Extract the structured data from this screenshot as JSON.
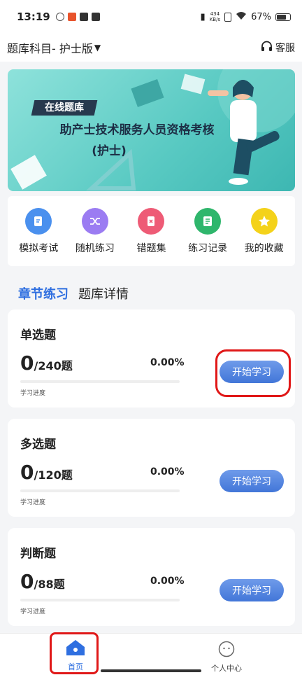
{
  "status_bar": {
    "time": "13:19",
    "net_speed_top": "434",
    "net_speed_unit": "KB/s",
    "battery": "67%"
  },
  "header": {
    "subject_label": "题库科目- 护士版",
    "service_label": "客服"
  },
  "banner": {
    "tag": "在线题库",
    "title": "助产士技术服务人员资格考核",
    "subtitle": "(护士)"
  },
  "quick_menu": {
    "items": [
      {
        "label": "模拟考试",
        "icon": "exam-icon",
        "color": "#4a90ee"
      },
      {
        "label": "随机练习",
        "icon": "shuffle-icon",
        "color": "#9b7cf2"
      },
      {
        "label": "错题集",
        "icon": "wrong-book-icon",
        "color": "#ee5b76"
      },
      {
        "label": "练习记录",
        "icon": "record-icon",
        "color": "#2fb66c"
      },
      {
        "label": "我的收藏",
        "icon": "star-icon",
        "color": "#f4d21a"
      }
    ]
  },
  "tabs": {
    "active": "章节练习",
    "other": "题库详情"
  },
  "cards": [
    {
      "title": "单选题",
      "done": "0",
      "total_text": "/240题",
      "percent": "0.00%",
      "progress_fraction": 0,
      "progress_label": "学习进度",
      "button_label": "开始学习"
    },
    {
      "title": "多选题",
      "done": "0",
      "total_text": "/120题",
      "percent": "0.00%",
      "progress_fraction": 0,
      "progress_label": "学习进度",
      "button_label": "开始学习"
    },
    {
      "title": "判断题",
      "done": "0",
      "total_text": "/88题",
      "percent": "0.00%",
      "progress_fraction": 0,
      "progress_label": "学习进度",
      "button_label": "开始学习"
    }
  ],
  "bottom_nav": {
    "home_label": "首页",
    "me_label": "个人中心"
  },
  "colors": {
    "accent": "#2f6fe0",
    "highlight": "#e01818"
  }
}
